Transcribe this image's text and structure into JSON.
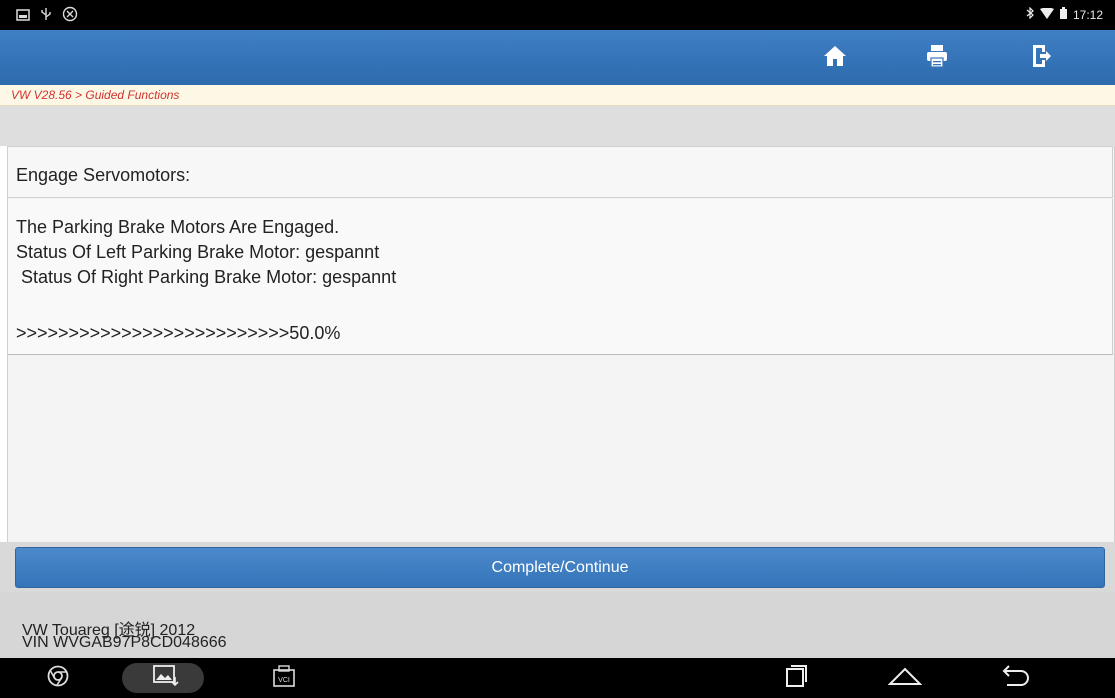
{
  "status_bar": {
    "left_icons": [
      "screenshot-icon",
      "usb-icon",
      "vci-status-icon"
    ],
    "time": "17:12",
    "right_icons": [
      "bluetooth-icon",
      "wifi-icon",
      "battery-icon"
    ]
  },
  "toolbar": {
    "buttons": [
      "home-icon",
      "print-icon",
      "exit-icon"
    ]
  },
  "breadcrumb": "VW V28.56 > Guided Functions",
  "content": {
    "title": "Engage Servomotors:",
    "lines": [
      "The Parking Brake Motors Are Engaged.",
      "Status Of Left Parking Brake Motor: gespannt",
      " Status Of Right Parking Brake Motor: gespannt"
    ],
    "progress_text": ">>>>>>>>>>>>>>>>>>>>>>>>>>50.0%"
  },
  "action": {
    "continue_label": "Complete/Continue"
  },
  "footer": {
    "vehicle": "VW Touareg [途锐] 2012",
    "vin": "VIN WVGAB97P8CD048666"
  },
  "colors": {
    "toolbar": "#3575bb",
    "breadcrumb_text": "#d0322e",
    "button": "#3f7fc4"
  }
}
